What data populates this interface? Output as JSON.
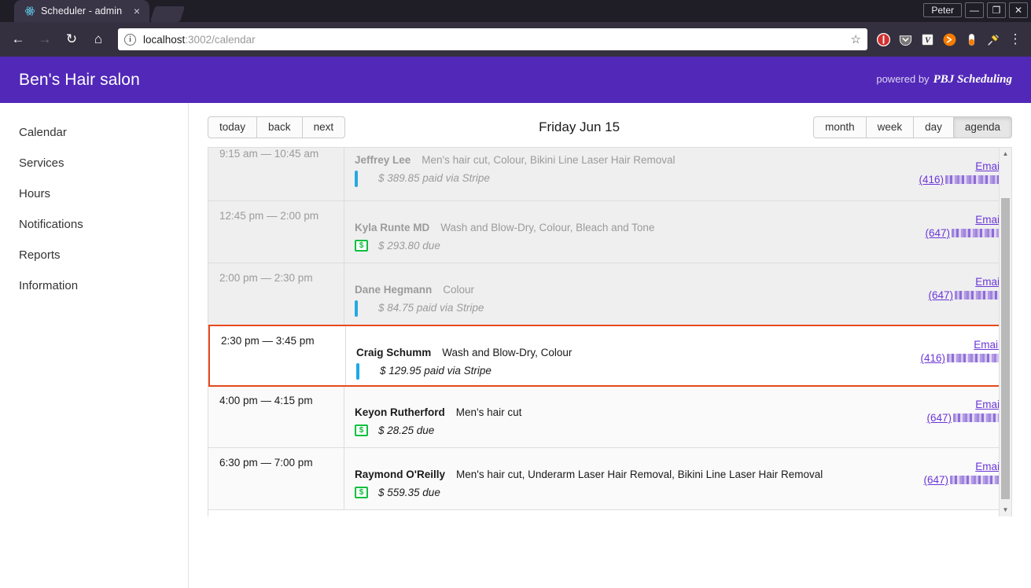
{
  "browser": {
    "tab_title": "Scheduler - admin",
    "tab_favicon": "react-atom-icon",
    "close_label": "×",
    "user_label": "Peter",
    "minimize_label": "—",
    "restore_label": "❐",
    "close_window_label": "✕",
    "back_label": "←",
    "forward_label": "→",
    "reload_label": "↻",
    "home_label": "⌂",
    "info_label": "i",
    "url_host": "localhost",
    "url_rest": ":3002/calendar",
    "star_label": "☆",
    "menu_label": "⋮"
  },
  "app": {
    "title": "Ben's Hair salon",
    "powered_by": "powered by",
    "brand": "PBJ Scheduling",
    "header_color": "#5128b8"
  },
  "sidebar": {
    "items": [
      {
        "label": "Calendar"
      },
      {
        "label": "Services"
      },
      {
        "label": "Hours"
      },
      {
        "label": "Notifications"
      },
      {
        "label": "Reports"
      },
      {
        "label": "Information"
      }
    ]
  },
  "toolbar": {
    "nav_buttons": [
      {
        "label": "today"
      },
      {
        "label": "back"
      },
      {
        "label": "next"
      }
    ],
    "title": "Friday Jun 15",
    "views": [
      {
        "label": "month",
        "active": false
      },
      {
        "label": "week",
        "active": false
      },
      {
        "label": "day",
        "active": false
      },
      {
        "label": "agenda",
        "active": true
      }
    ]
  },
  "agenda": {
    "email_label": "Email",
    "highlight_color": "#e8491d",
    "rows": [
      {
        "time": "9:15 am — 10:45 am",
        "name": "Jeffrey Lee",
        "services": "Men's hair cut, Colour, Bikini Line Laser Hair Removal",
        "pay_icon": "credit-card-icon",
        "amount": "$ 389.85 paid via Stripe",
        "phone_prefix": "(416)",
        "state": "past",
        "clipped": true
      },
      {
        "time": "12:45 pm — 2:00 pm",
        "name": "Kyla Runte MD",
        "services": "Wash and Blow-Dry, Colour, Bleach and Tone",
        "pay_icon": "money-due-icon",
        "amount": "$ 293.80 due",
        "phone_prefix": "(647)",
        "state": "past",
        "clipped": false
      },
      {
        "time": "2:00 pm — 2:30 pm",
        "name": "Dane Hegmann",
        "services": "Colour",
        "pay_icon": "credit-card-icon",
        "amount": "$ 84.75 paid via Stripe",
        "phone_prefix": "(647)",
        "state": "past",
        "clipped": false
      },
      {
        "time": "2:30 pm — 3:45 pm",
        "name": "Craig Schumm",
        "services": "Wash and Blow-Dry, Colour",
        "pay_icon": "credit-card-icon",
        "amount": "$ 129.95 paid via Stripe",
        "phone_prefix": "(416)",
        "state": "highlight",
        "clipped": false
      },
      {
        "time": "4:00 pm — 4:15 pm",
        "name": "Keyon Rutherford",
        "services": "Men's hair cut",
        "pay_icon": "money-due-icon",
        "amount": "$ 28.25 due",
        "phone_prefix": "(647)",
        "state": "upcoming",
        "clipped": false
      },
      {
        "time": "6:30 pm — 7:00 pm",
        "name": "Raymond O'Reilly",
        "services": "Men's hair cut, Underarm Laser Hair Removal, Bikini Line Laser Hair Removal",
        "pay_icon": "money-due-icon",
        "amount": "$ 559.35 due",
        "phone_prefix": "(647)",
        "state": "upcoming",
        "clipped": false
      }
    ],
    "scroll_up_label": "▲",
    "scroll_down_label": "▼"
  }
}
